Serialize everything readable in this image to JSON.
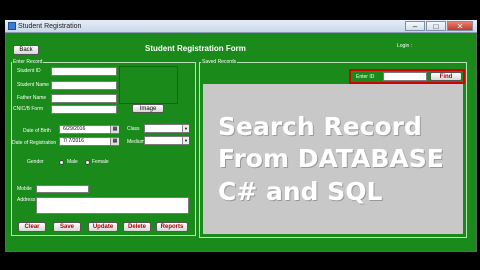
{
  "window": {
    "title": "Student Registration",
    "controls": {
      "minimize": "–",
      "maximize": "□",
      "close": "✕"
    }
  },
  "header": {
    "back_label": "Back",
    "form_title": "Student Registration Form",
    "login_label": "Login :"
  },
  "enter_record": {
    "group_title": "Enter Record",
    "student_id_label": "Student ID",
    "student_name_label": "Student Name",
    "father_name_label": "Father Name",
    "cnic_label": "CNIC/B Form",
    "image_button": "Image",
    "dob_label": "Date of Birth",
    "dob_value": "6/29/2016",
    "dor_label": "Date of Registration",
    "dor_value": "7/ 7/2016",
    "class_label": "Class",
    "medium_label": "Medium",
    "gender_label": "Gender",
    "male_label": "Male",
    "female_label": "Female",
    "mobile_label": "Mobile",
    "address_label": "Address"
  },
  "actions": {
    "clear": "Clear",
    "save": "Save",
    "update": "Update",
    "delete": "Delete",
    "reports": "Reports"
  },
  "saved_records": {
    "group_title": "Saved Records",
    "enter_id_label": "Enter ID",
    "find_button": "Find",
    "overlay_line1": "Search Record",
    "overlay_line2": "From DATABASE",
    "overlay_line3": "C# and SQL"
  },
  "colors": {
    "form_green": "#1a8a1a",
    "highlight_red": "#d20000",
    "button_text_red": "#b00000",
    "grid_gray": "#c8c8c8"
  }
}
